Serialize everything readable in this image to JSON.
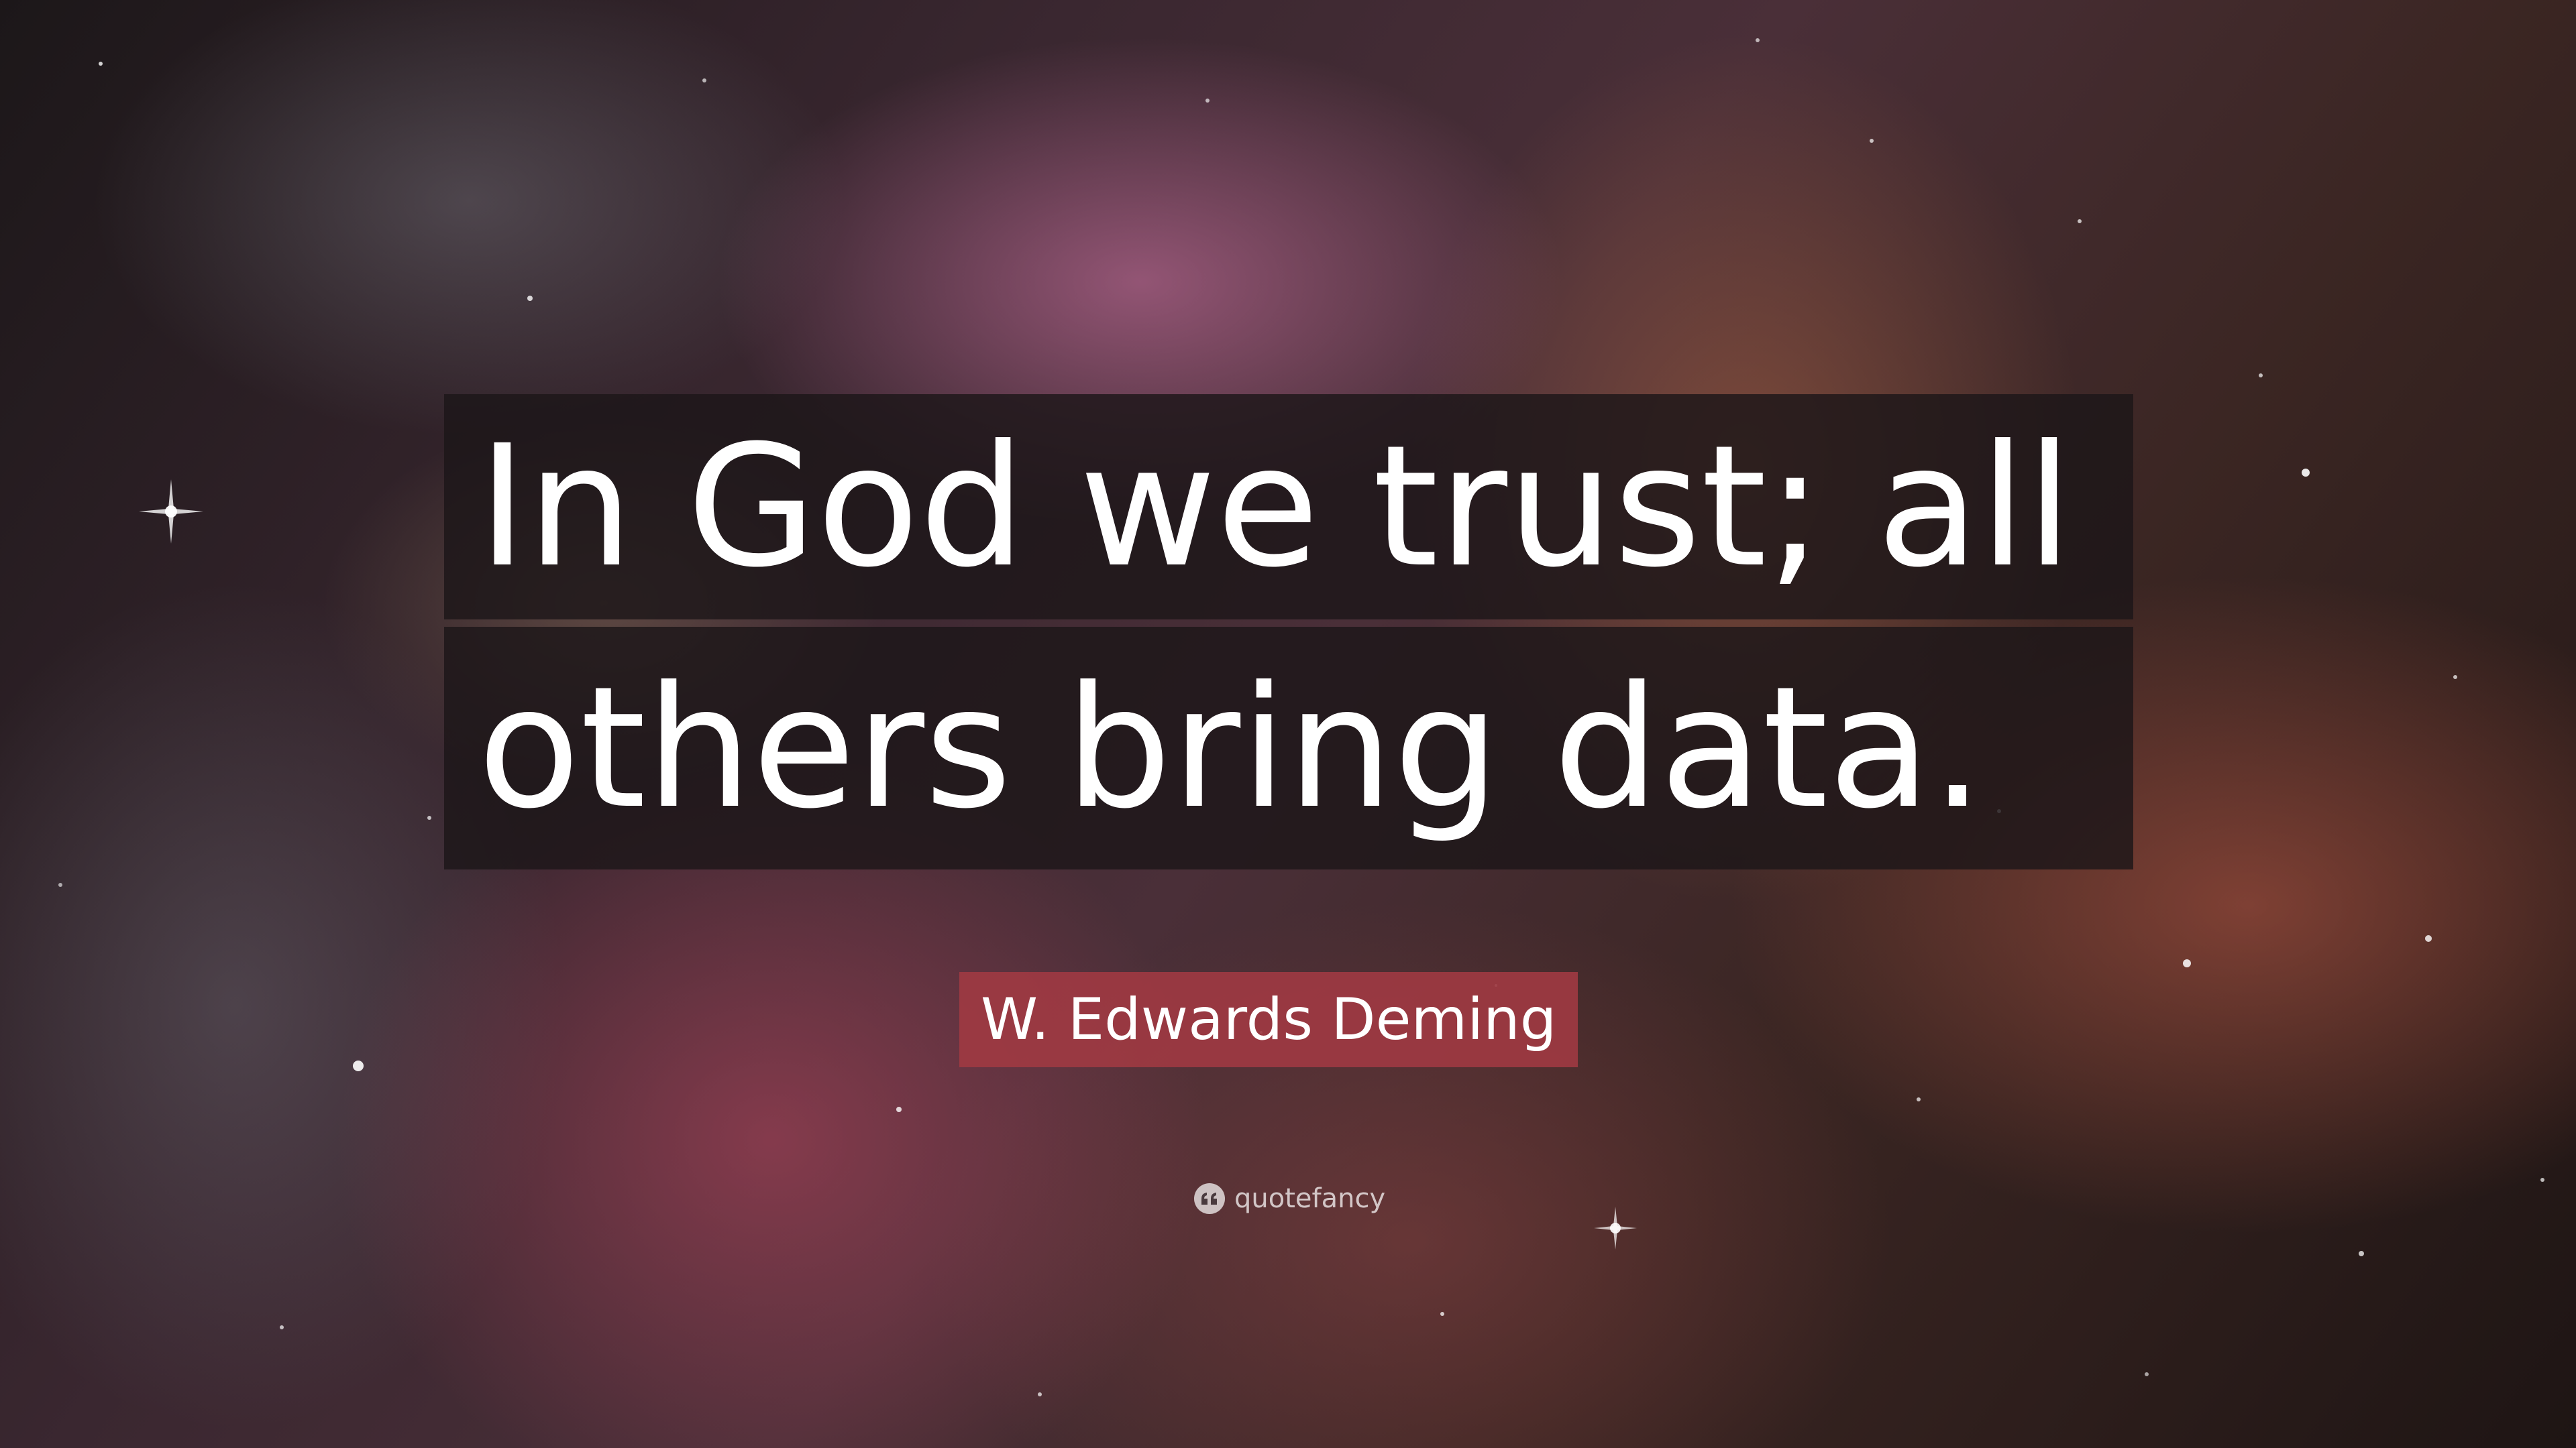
{
  "quote": {
    "line1": "In God we trust; all",
    "line2": "others bring data."
  },
  "author": {
    "name": "W. Edwards Deming"
  },
  "branding": {
    "icon": "quote-marks-icon",
    "text": "quotefancy"
  },
  "colors": {
    "quote_box": "#1c1618",
    "author_box": "#a03a42",
    "text": "#ffffff"
  }
}
